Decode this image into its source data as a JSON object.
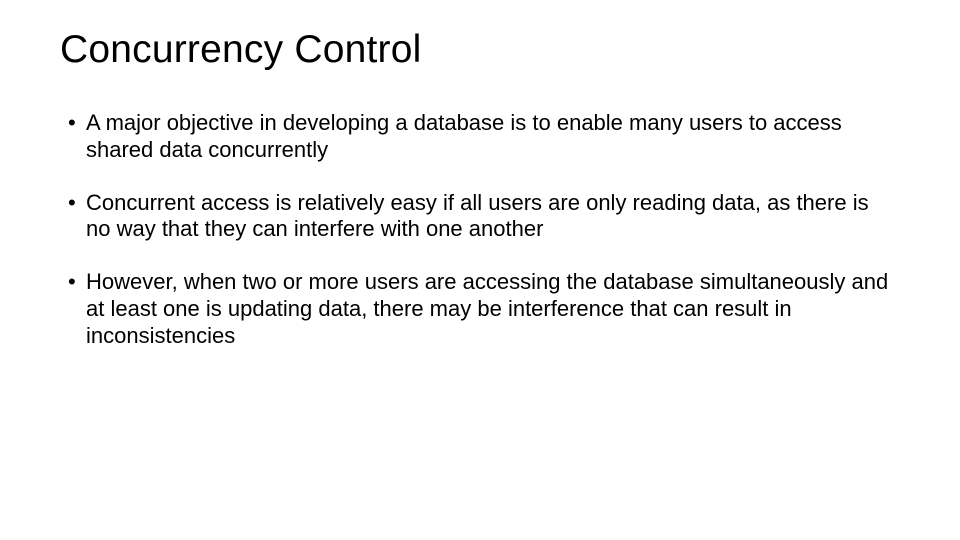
{
  "slide": {
    "title": "Concurrency Control",
    "bullets": [
      "A major objective in developing a database is to enable many users to access shared data concurrently",
      "Concurrent access is relatively easy if all users are only reading data, as there is no way that they can interfere with one another",
      "However, when two or more users are accessing the database simultaneously and at least one is updating data, there may be interference that can result in inconsistencies"
    ]
  }
}
